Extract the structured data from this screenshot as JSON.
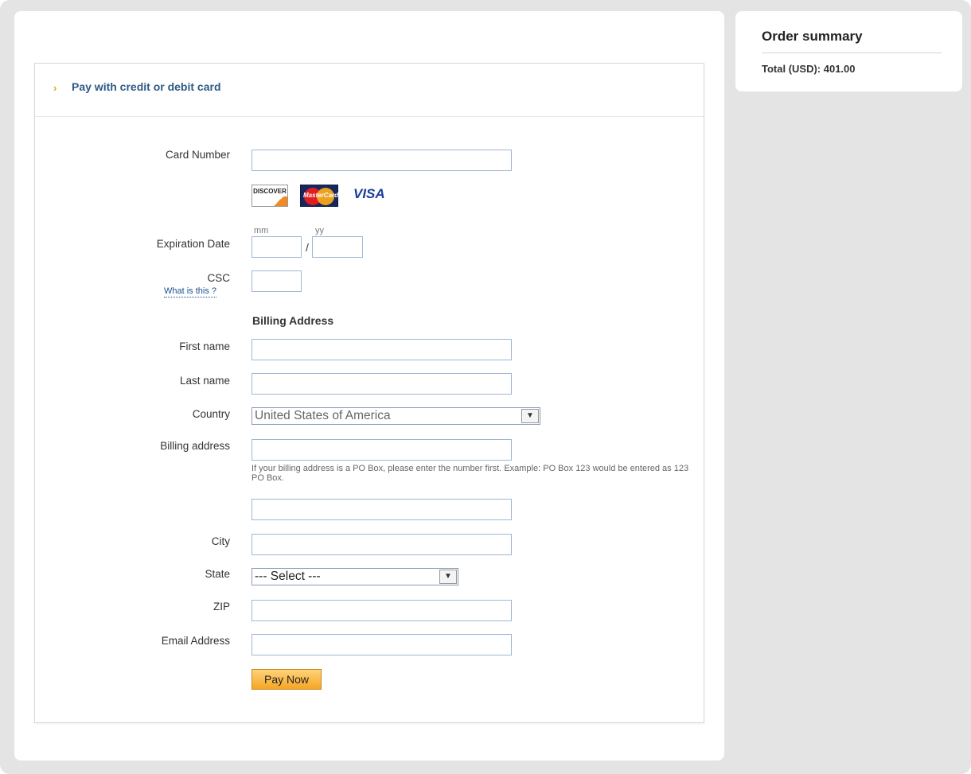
{
  "order_summary": {
    "title": "Order summary",
    "total": "Total (USD): 401.00"
  },
  "form": {
    "header_title": "Pay with credit or debit card",
    "card_number_label": "Card Number",
    "cards": {
      "discover": "DISCOVER",
      "mastercard": "MasterCard",
      "visa": "VISA"
    },
    "expiration_label": "Expiration Date",
    "mm_label": "mm",
    "yy_label": "yy",
    "slash": "/",
    "csc_label": "CSC",
    "csc_help_link": "What is this ?",
    "billing_section_title": "Billing Address",
    "first_name_label": "First name",
    "last_name_label": "Last name",
    "country_label": "Country",
    "country_value": "United States of America",
    "billing_address_label": "Billing address",
    "billing_help": "If your billing address is a PO Box, please enter the number first. Example: PO Box 123 would be entered as 123 PO Box.",
    "city_label": "City",
    "state_label": "State",
    "state_value": "--- Select ---",
    "zip_label": "ZIP",
    "email_label": "Email Address",
    "pay_button": "Pay Now"
  },
  "colors": {
    "accent_link": "#2f5a86",
    "button": "#f5a623",
    "panel_bg": "#e4e4e4"
  }
}
